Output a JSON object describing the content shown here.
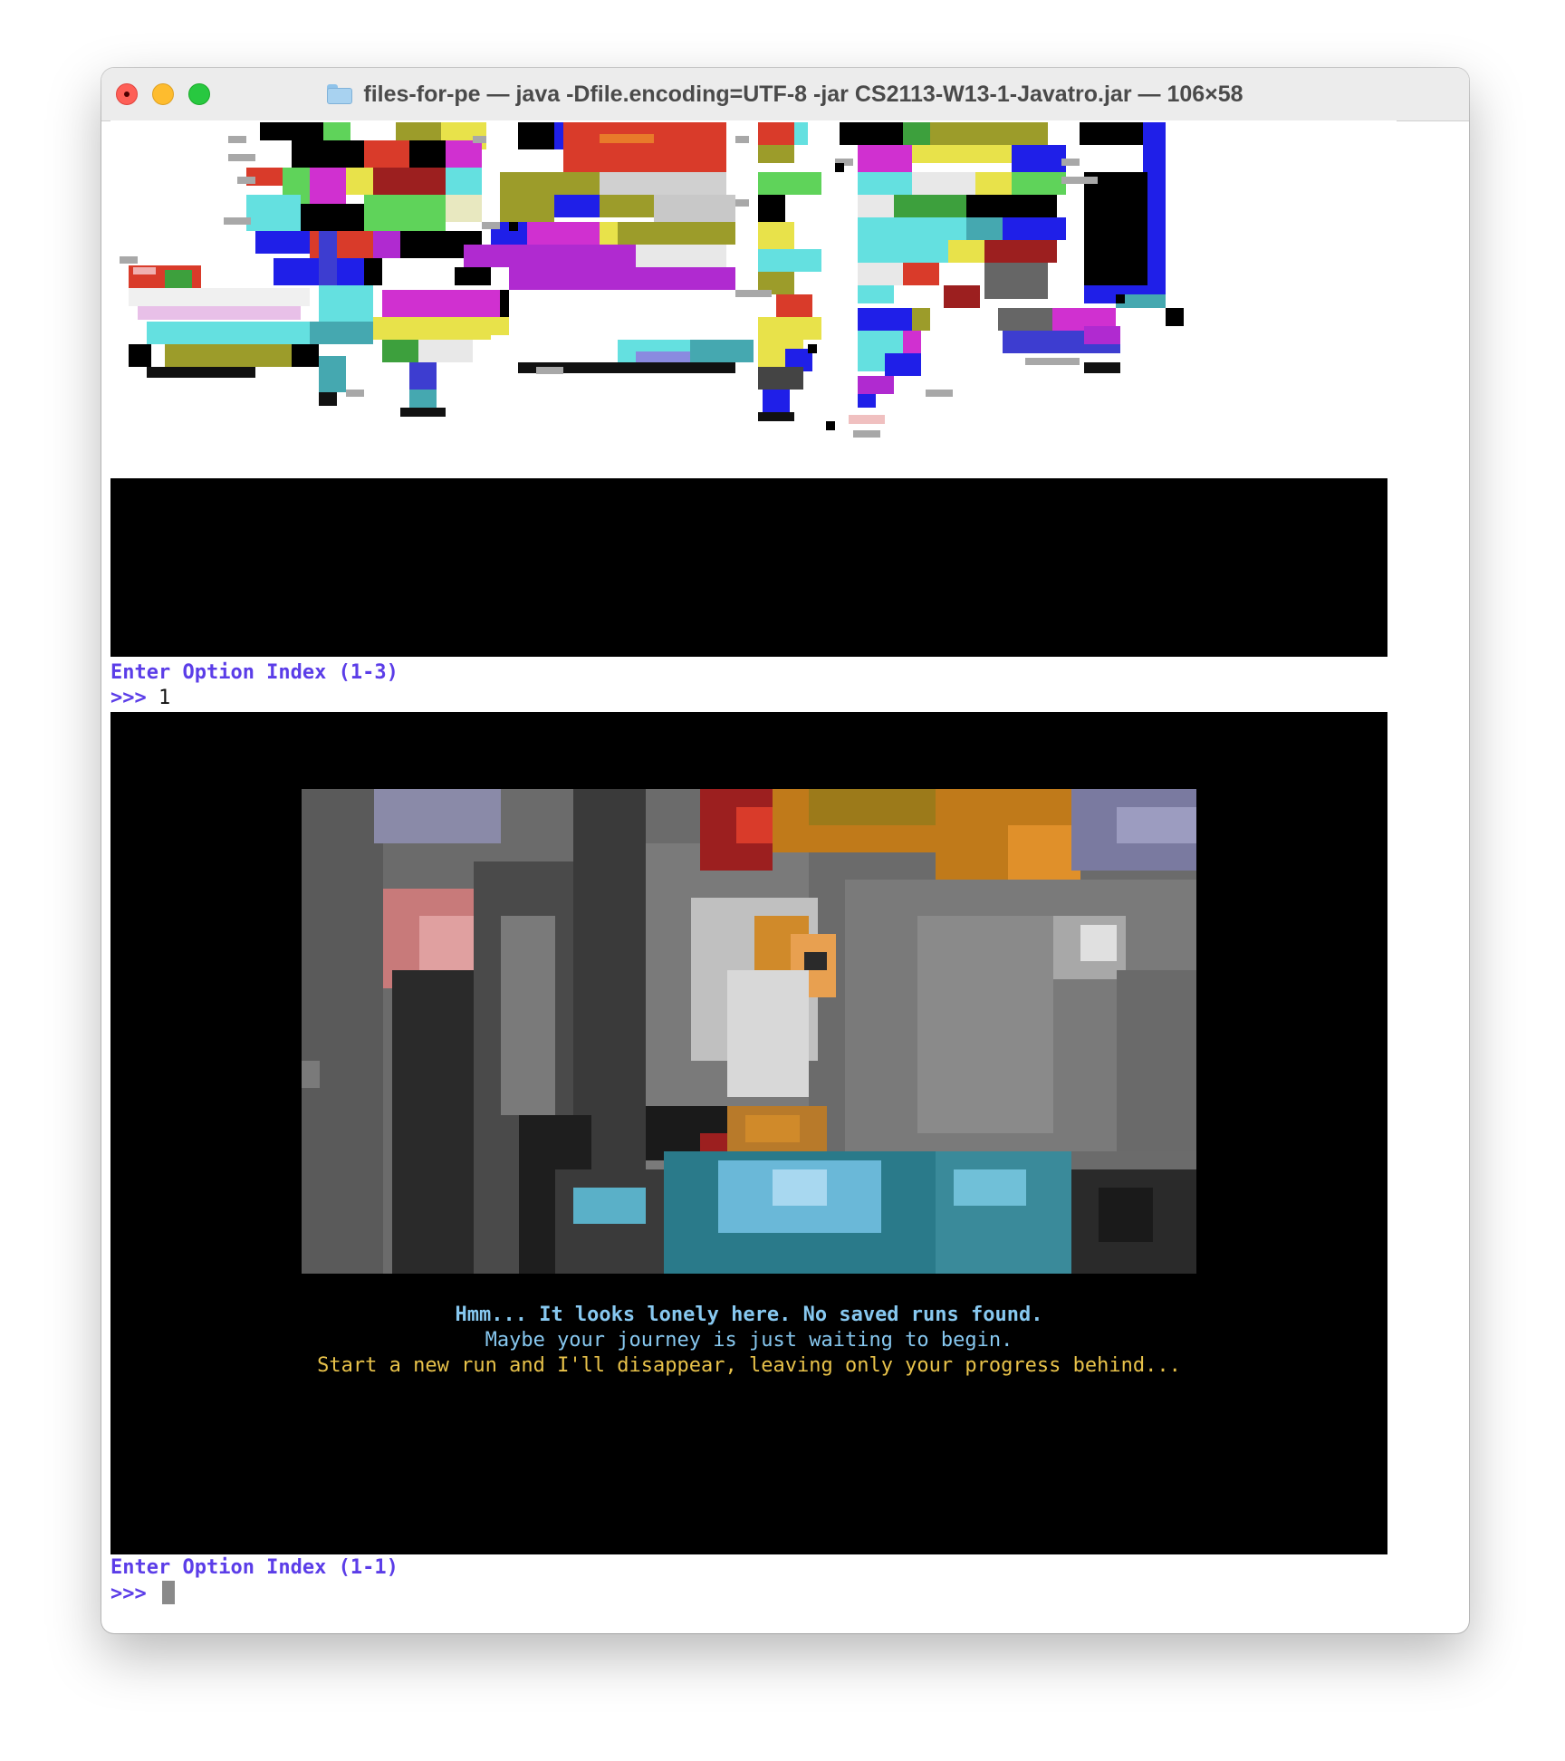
{
  "window": {
    "title": "files-for-pe — java -Dfile.encoding=UTF-8 -jar CS2113-W13-1-Javatro.jar — 106×58",
    "folder_icon": "folder-icon",
    "traffic_lights": [
      "close",
      "minimize",
      "maximize"
    ]
  },
  "terminal": {
    "banner_logo": "JAVATRO pixel art banner",
    "first_prompt": {
      "label": "Enter Option Index (1-3)",
      "arrow": ">>>",
      "input": "1"
    },
    "lonely_screen": {
      "portrait": "pixelated joker portrait",
      "lines": [
        "Hmm... It looks lonely here. No saved runs found.",
        "Maybe your journey is just waiting to begin.",
        "Start a new run and I'll disappear, leaving only your progress behind..."
      ],
      "line_colors": [
        "#87c8f0",
        "#87c8f0",
        "#e8c24a"
      ]
    },
    "second_prompt": {
      "label": "Enter Option Index (1-1)",
      "arrow": ">>>",
      "input": ""
    }
  },
  "colors": {
    "prompt_accent": "#5b3de8",
    "panel_background": "#000000"
  }
}
